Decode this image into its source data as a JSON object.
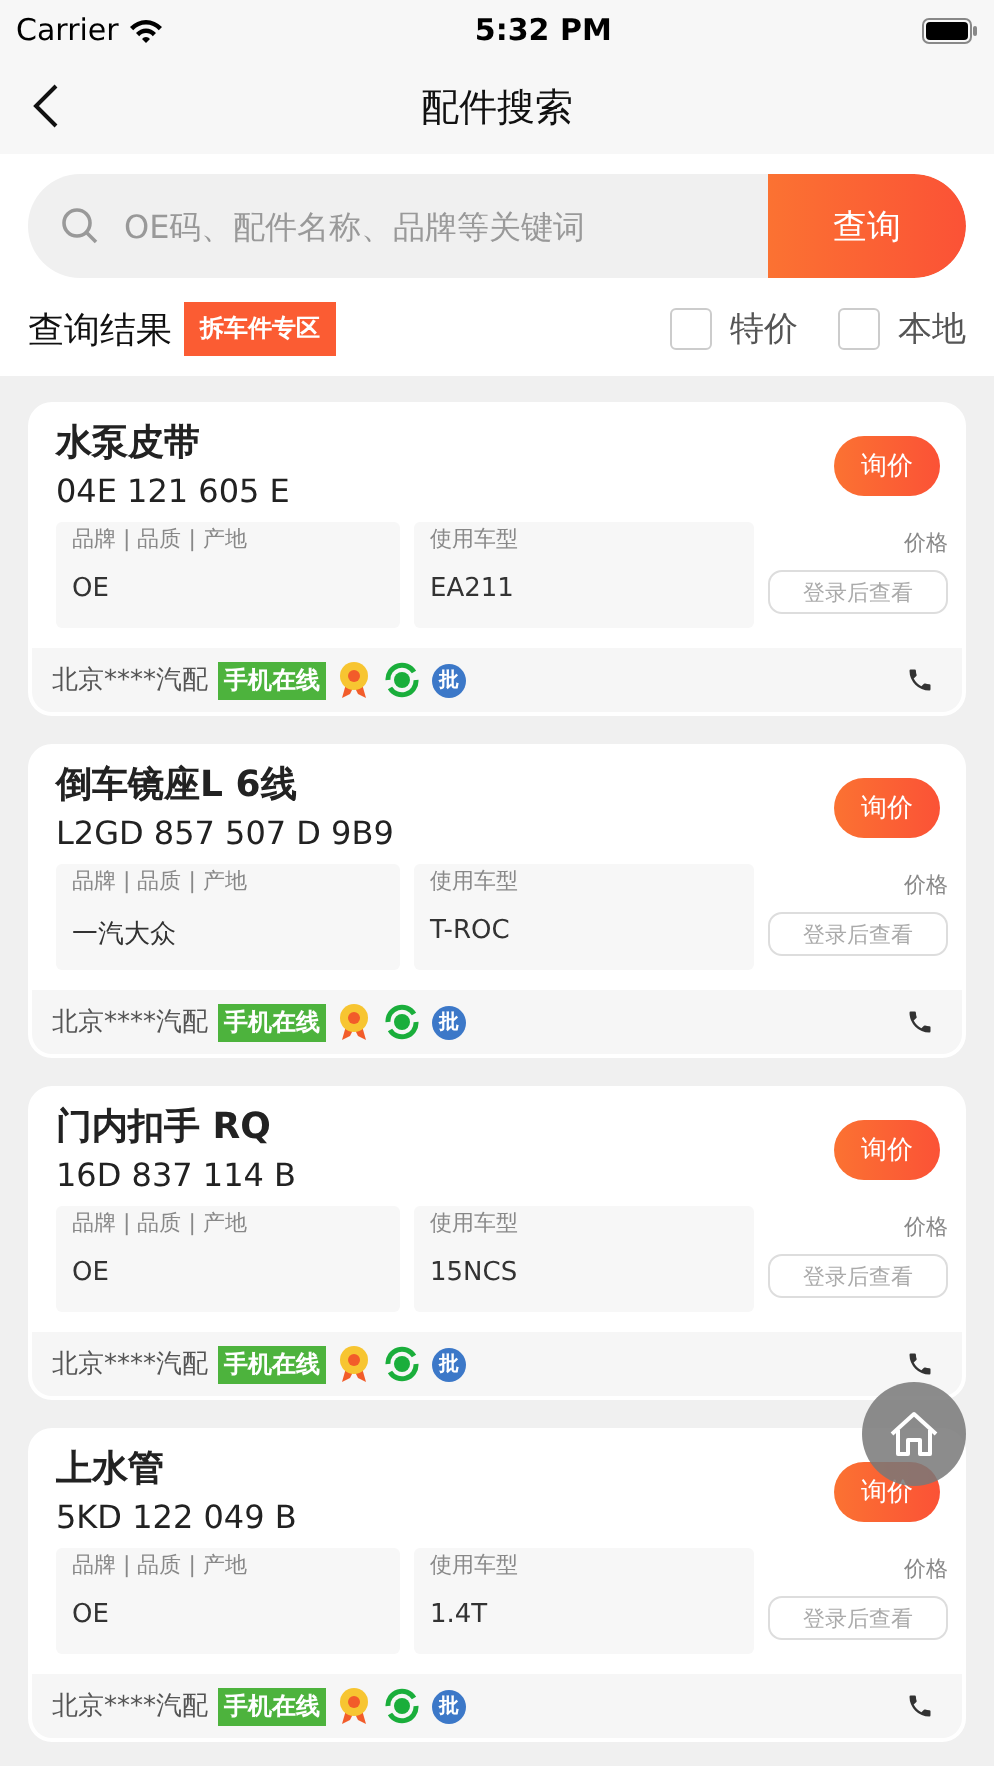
{
  "status_bar": {
    "carrier": "Carrier",
    "time": "5:32 PM"
  },
  "nav": {
    "title": "配件搜索"
  },
  "search": {
    "placeholder": "OE码、配件名称、品牌等关键词",
    "button": "查询"
  },
  "results_header": {
    "title": "查询结果",
    "tag": "拆车件专区",
    "filters": [
      {
        "label": "特价",
        "checked": false
      },
      {
        "label": "本地",
        "checked": false
      }
    ]
  },
  "results": [
    {
      "name": "水泵皮带",
      "code": "04E 121 605 E",
      "brand_label": "品牌 | 品质 | 产地",
      "brand": "OE",
      "model_label": "使用车型",
      "model": "EA211",
      "price_label": "价格",
      "price_button": "登录后查看",
      "inquiry": "询价",
      "seller": "北京****汽配",
      "online": "手机在线",
      "wholesale": "批"
    },
    {
      "name": "倒车镜座L 6线",
      "code": "L2GD 857 507 D 9B9",
      "brand_label": "品牌 | 品质 | 产地",
      "brand": "一汽大众",
      "model_label": "使用车型",
      "model": "T-ROC",
      "price_label": "价格",
      "price_button": "登录后查看",
      "inquiry": "询价",
      "seller": "北京****汽配",
      "online": "手机在线",
      "wholesale": "批"
    },
    {
      "name": "门内扣手 RQ",
      "code": "16D 837 114 B",
      "brand_label": "品牌 | 品质 | 产地",
      "brand": "OE",
      "model_label": "使用车型",
      "model": "15NCS",
      "price_label": "价格",
      "price_button": "登录后查看",
      "inquiry": "询价",
      "seller": "北京****汽配",
      "online": "手机在线",
      "wholesale": "批"
    },
    {
      "name": "上水管",
      "code": "5KD 122 049 B",
      "brand_label": "品牌 | 品质 | 产地",
      "brand": "OE",
      "model_label": "使用车型",
      "model": "1.4T",
      "price_label": "价格",
      "price_button": "登录后查看",
      "inquiry": "询价",
      "seller": "北京****汽配",
      "online": "手机在线",
      "wholesale": "批"
    }
  ]
}
